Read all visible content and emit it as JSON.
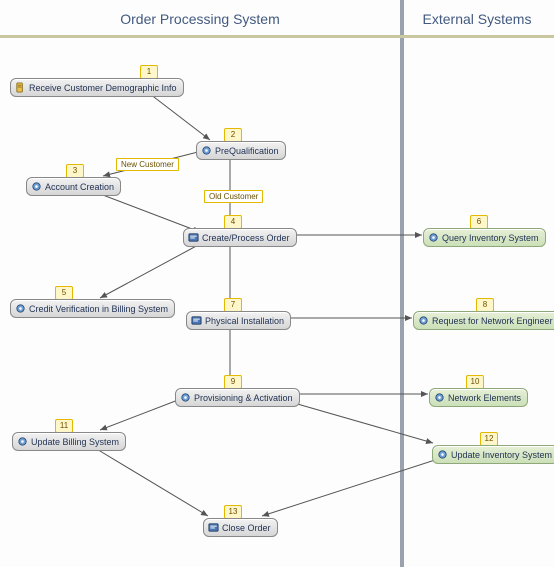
{
  "lanes": {
    "left": "Order Processing System",
    "right": "External Systems"
  },
  "tags": {
    "new_customer": "New Customer",
    "old_customer": "Old Customer"
  },
  "nodes": {
    "n1": {
      "num": "1",
      "label": "Receive Customer Demographic Info"
    },
    "n2": {
      "num": "2",
      "label": "PreQualification"
    },
    "n3": {
      "num": "3",
      "label": "Account Creation"
    },
    "n4": {
      "num": "4",
      "label": "Create/Process Order"
    },
    "n5": {
      "num": "5",
      "label": "Credit Verification in Billing System"
    },
    "n6": {
      "num": "6",
      "label": "Query Inventory System"
    },
    "n7": {
      "num": "7",
      "label": "Physical Installation"
    },
    "n8": {
      "num": "8",
      "label": "Request for Network Engineer visit"
    },
    "n9": {
      "num": "9",
      "label": "Provisioning & Activation"
    },
    "n10": {
      "num": "10",
      "label": "Network Elements"
    },
    "n11": {
      "num": "11",
      "label": "Update Billing System"
    },
    "n12": {
      "num": "12",
      "label": "Update Inventory System"
    },
    "n13": {
      "num": "13",
      "label": "Close Order"
    }
  },
  "chart_data": {
    "type": "flowchart",
    "lanes": [
      {
        "id": "ops",
        "title": "Order Processing System"
      },
      {
        "id": "ext",
        "title": "External Systems"
      }
    ],
    "nodes": [
      {
        "id": 1,
        "lane": "ops",
        "label": "Receive Customer Demographic Info"
      },
      {
        "id": 2,
        "lane": "ops",
        "label": "PreQualification"
      },
      {
        "id": 3,
        "lane": "ops",
        "label": "Account Creation"
      },
      {
        "id": 4,
        "lane": "ops",
        "label": "Create/Process Order"
      },
      {
        "id": 5,
        "lane": "ops",
        "label": "Credit Verification in Billing System"
      },
      {
        "id": 6,
        "lane": "ext",
        "label": "Query Inventory System"
      },
      {
        "id": 7,
        "lane": "ops",
        "label": "Physical Installation"
      },
      {
        "id": 8,
        "lane": "ext",
        "label": "Request for Network Engineer visit"
      },
      {
        "id": 9,
        "lane": "ops",
        "label": "Provisioning & Activation"
      },
      {
        "id": 10,
        "lane": "ext",
        "label": "Network Elements"
      },
      {
        "id": 11,
        "lane": "ops",
        "label": "Update Billing System"
      },
      {
        "id": 12,
        "lane": "ext",
        "label": "Update Inventory System"
      },
      {
        "id": 13,
        "lane": "ops",
        "label": "Close Order"
      }
    ],
    "edges": [
      {
        "from": 1,
        "to": 2
      },
      {
        "from": 2,
        "to": 3,
        "label": "New Customer"
      },
      {
        "from": 2,
        "to": 4,
        "label": "Old Customer"
      },
      {
        "from": 3,
        "to": 4
      },
      {
        "from": 4,
        "to": 5
      },
      {
        "from": 4,
        "to": 6
      },
      {
        "from": 4,
        "to": 7
      },
      {
        "from": 7,
        "to": 8
      },
      {
        "from": 7,
        "to": 9
      },
      {
        "from": 9,
        "to": 10
      },
      {
        "from": 9,
        "to": 11
      },
      {
        "from": 9,
        "to": 12
      },
      {
        "from": 11,
        "to": 13
      },
      {
        "from": 12,
        "to": 13
      }
    ]
  }
}
